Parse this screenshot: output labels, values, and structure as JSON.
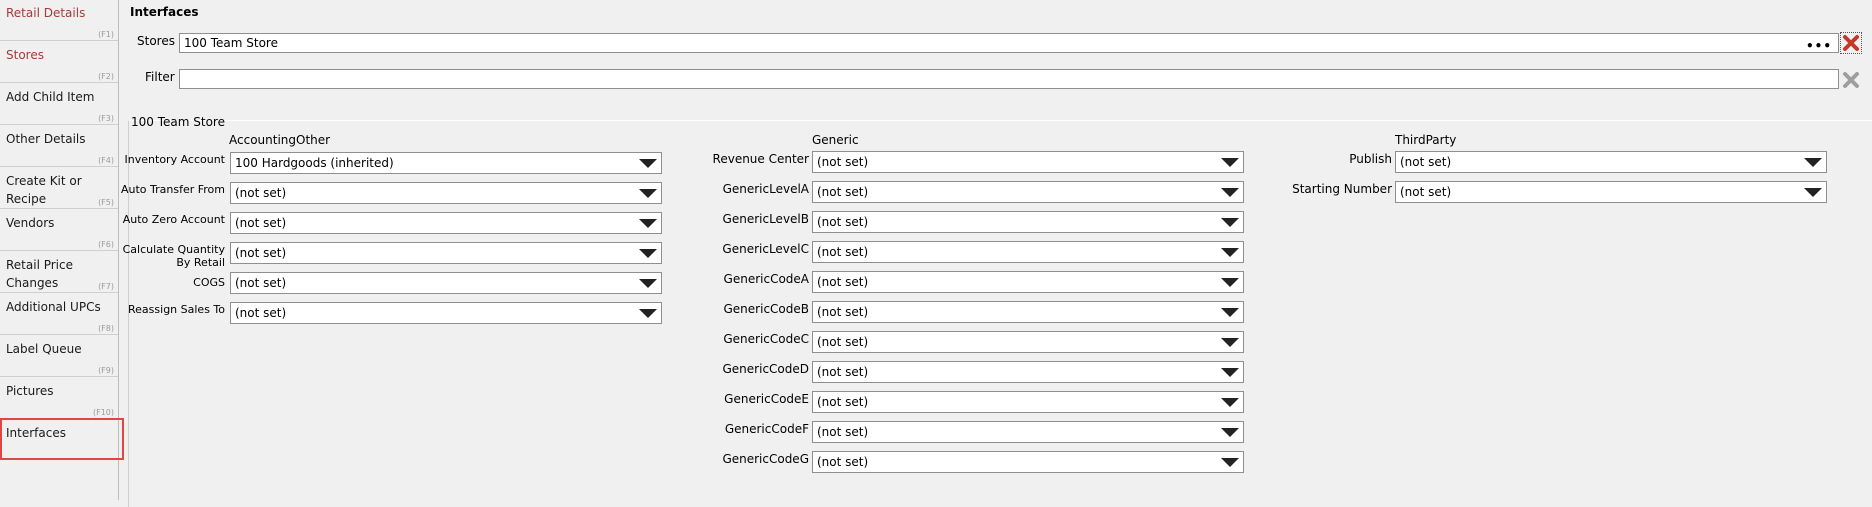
{
  "sidebar": {
    "items": [
      {
        "label": "Retail Details",
        "key": "(F1)"
      },
      {
        "label": "Stores",
        "key": "(F2)"
      },
      {
        "label": "Add Child Item",
        "key": "(F3)"
      },
      {
        "label": "Other Details",
        "key": "(F4)"
      },
      {
        "label": "Create Kit or Recipe",
        "key": "(F5)"
      },
      {
        "label": "Vendors",
        "key": "(F6)"
      },
      {
        "label": "Retail Price Changes",
        "key": "(F7)"
      },
      {
        "label": "Additional UPCs",
        "key": "(F8)"
      },
      {
        "label": "Label Queue",
        "key": "(F9)"
      },
      {
        "label": "Pictures",
        "key": "(F10)"
      },
      {
        "label": "Interfaces",
        "key": ""
      }
    ]
  },
  "page": {
    "title": "Interfaces",
    "stores_label": "Stores",
    "stores_value": "100 Team Store",
    "ellipsis": "•••",
    "filter_label": "Filter",
    "filter_value": ""
  },
  "section": {
    "title": "100 Team Store",
    "columns": {
      "accounting": {
        "header": "AccountingOther",
        "fields": [
          {
            "label": "Inventory Account",
            "value": "100 Hardgoods (inherited)"
          },
          {
            "label": "Auto Transfer From",
            "value": "(not set)"
          },
          {
            "label": "Auto Zero Account",
            "value": "(not set)"
          },
          {
            "label": "Calculate Quantity By Retail",
            "value": "(not set)"
          },
          {
            "label": "COGS",
            "value": "(not set)"
          },
          {
            "label": "Reassign Sales To",
            "value": "(not set)"
          }
        ]
      },
      "generic": {
        "header": "Generic",
        "fields": [
          {
            "label": "Revenue Center",
            "value": "(not set)"
          },
          {
            "label": "GenericLevelA",
            "value": "(not set)"
          },
          {
            "label": "GenericLevelB",
            "value": "(not set)"
          },
          {
            "label": "GenericLevelC",
            "value": "(not set)"
          },
          {
            "label": "GenericCodeA",
            "value": "(not set)"
          },
          {
            "label": "GenericCodeB",
            "value": "(not set)"
          },
          {
            "label": "GenericCodeC",
            "value": "(not set)"
          },
          {
            "label": "GenericCodeD",
            "value": "(not set)"
          },
          {
            "label": "GenericCodeE",
            "value": "(not set)"
          },
          {
            "label": "GenericCodeF",
            "value": "(not set)"
          },
          {
            "label": "GenericCodeG",
            "value": "(not set)"
          }
        ]
      },
      "thirdparty": {
        "header": "ThirdParty",
        "fields": [
          {
            "label": "Publish",
            "value": "(not set)"
          },
          {
            "label": "Starting Number",
            "value": "(not set)"
          }
        ]
      }
    }
  },
  "colors": {
    "nav_active_text": "#a23b3b",
    "highlight": "#e04646",
    "clear_active": "#c0392b",
    "clear_inactive": "#9e9e9e"
  }
}
